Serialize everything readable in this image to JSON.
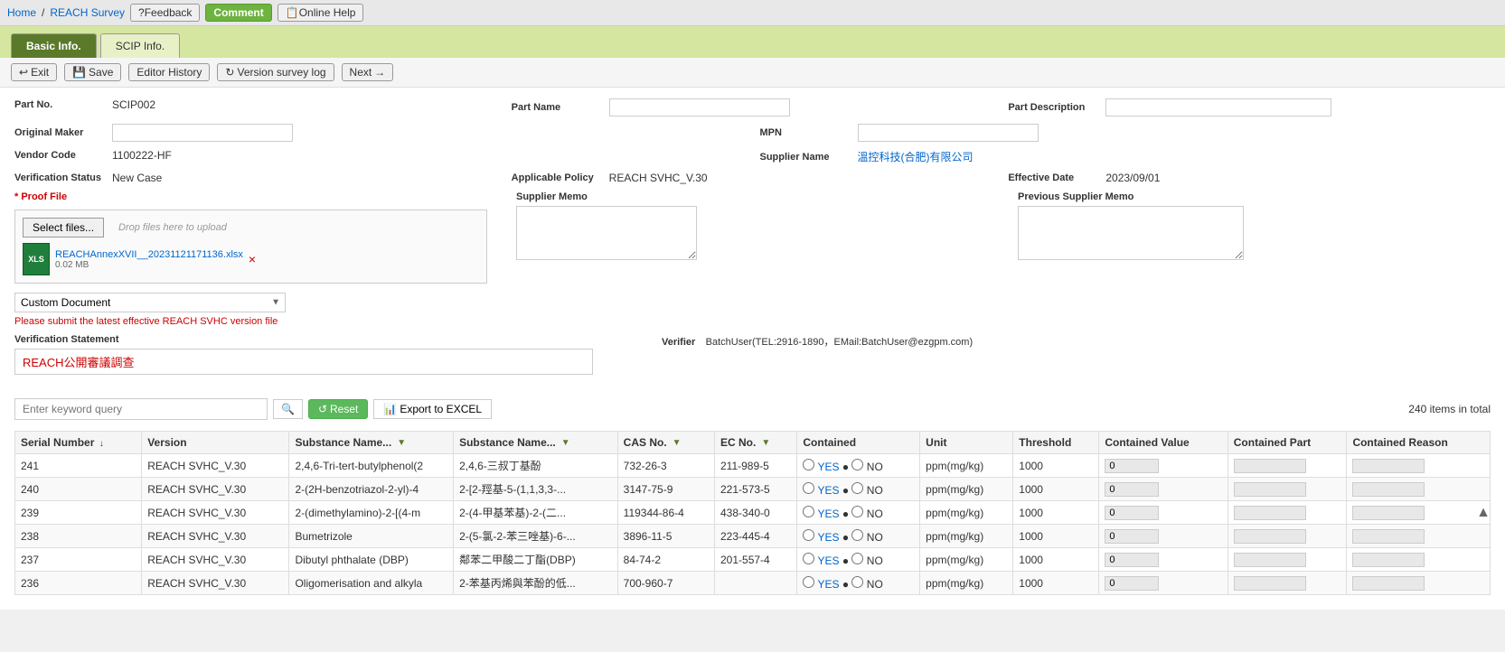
{
  "topNav": {
    "homeLabel": "Home",
    "separator": "/",
    "surveyLabel": "REACH Survey",
    "feedbackLabel": "?Feedback",
    "commentLabel": "Comment",
    "onlineHelpLabel": "📋Online Help"
  },
  "tabs": [
    {
      "id": "basic-info",
      "label": "Basic Info.",
      "active": true
    },
    {
      "id": "scip-info",
      "label": "SCIP Info.",
      "active": false
    }
  ],
  "toolbar": {
    "exitLabel": "Exit",
    "saveLabel": "Save",
    "editorHistoryLabel": "Editor History",
    "versionSurveyLogLabel": "Version survey log",
    "nextLabel": "Next",
    "nextArrow": "→"
  },
  "form": {
    "partNoLabel": "Part No.",
    "partNoValue": "SCIP002",
    "partNameLabel": "Part Name",
    "partNameValue": "",
    "partDescriptionLabel": "Part Description",
    "partDescriptionValue": "",
    "originalMakerLabel": "Original Maker",
    "originalMakerValue": "",
    "mpnLabel": "MPN",
    "mpnValue": "",
    "vendorCodeLabel": "Vendor Code",
    "vendorCodeValue": "1100222-HF",
    "supplierNameLabel": "Supplier Name",
    "supplierNameValue": "溫控科技(合肥)有限公司",
    "verificationStatusLabel": "Verification Status",
    "verificationStatusValue": "New Case",
    "applicablePolicyLabel": "Applicable Policy",
    "applicablePolicyValue": "REACH SVHC_V.30",
    "effectiveDateLabel": "Effective Date",
    "effectiveDateValue": "2023/09/01",
    "proofFileLabel": "* Proof File",
    "selectFilesLabel": "Select files...",
    "dropFilesLabel": "Drop files here to upload",
    "fileName": "REACHAnnexXVII__20231121171136.xlsx",
    "fileSize": "0.02 MB",
    "customDocumentLabel": "Custom Document",
    "warningText": "Please submit the latest effective REACH SVHC version file",
    "supplierMemoLabel": "Supplier Memo",
    "previousSupplierMemoLabel": "Previous Supplier Memo",
    "verificationStatementLabel": "Verification Statement",
    "verificationStatementValue": "REACH公開審議調查",
    "verifierLabel": "Verifier",
    "verifierValue": "BatchUser(TEL:2916-1890，EMail:BatchUser@ezgpm.com)"
  },
  "search": {
    "placeholder": "Enter keyword query",
    "resetLabel": "Reset",
    "exportLabel": "Export to EXCEL",
    "totalItems": "240 items in total"
  },
  "table": {
    "columns": [
      {
        "id": "serial",
        "label": "Serial Number",
        "sortable": true
      },
      {
        "id": "version",
        "label": "Version",
        "sortable": false
      },
      {
        "id": "substanceNameEn",
        "label": "Substance Name...",
        "filterable": true
      },
      {
        "id": "substanceNameZh",
        "label": "Substance Name...",
        "filterable": true
      },
      {
        "id": "casNo",
        "label": "CAS No.",
        "filterable": true
      },
      {
        "id": "ecNo",
        "label": "EC No.",
        "filterable": true
      },
      {
        "id": "contained",
        "label": "Contained",
        "sortable": false
      },
      {
        "id": "unit",
        "label": "Unit",
        "sortable": false
      },
      {
        "id": "threshold",
        "label": "Threshold",
        "sortable": false
      },
      {
        "id": "containedValue",
        "label": "Contained Value",
        "sortable": false
      },
      {
        "id": "containedPart",
        "label": "Contained Part",
        "sortable": false
      },
      {
        "id": "containedReason",
        "label": "Contained Reason",
        "sortable": false
      }
    ],
    "rows": [
      {
        "serial": "241",
        "version": "REACH SVHC_V.30",
        "substanceNameEn": "2,4,6-Tri-tert-butylphenol(2",
        "substanceNameZh": "2,4,6-三叔丁基酚",
        "casNo": "732-26-3",
        "ecNo": "211-989-5",
        "containedYes": "YES",
        "containedNo": "NO",
        "unit": "ppm(mg/kg)",
        "threshold": "1000",
        "containedValue": "0",
        "containedPart": "",
        "containedReason": ""
      },
      {
        "serial": "240",
        "version": "REACH SVHC_V.30",
        "substanceNameEn": "2-(2H-benzotriazol-2-yl)-4",
        "substanceNameZh": "2-[2-羥基-5-(1,1,3,3-...",
        "casNo": "3147-75-9",
        "ecNo": "221-573-5",
        "containedYes": "YES",
        "containedNo": "NO",
        "unit": "ppm(mg/kg)",
        "threshold": "1000",
        "containedValue": "0",
        "containedPart": "",
        "containedReason": ""
      },
      {
        "serial": "239",
        "version": "REACH SVHC_V.30",
        "substanceNameEn": "2-(dimethylamino)-2-[(4-m",
        "substanceNameZh": "2-(4-甲基苯基)-2-(二...",
        "casNo": "119344-86-4",
        "ecNo": "438-340-0",
        "containedYes": "YES",
        "containedNo": "NO",
        "unit": "ppm(mg/kg)",
        "threshold": "1000",
        "containedValue": "0",
        "containedPart": "",
        "containedReason": ""
      },
      {
        "serial": "238",
        "version": "REACH SVHC_V.30",
        "substanceNameEn": "Bumetrizole",
        "substanceNameZh": "2-(5-氯-2-苯三唑基)-6-...",
        "casNo": "3896-11-5",
        "ecNo": "223-445-4",
        "containedYes": "YES",
        "containedNo": "NO",
        "unit": "ppm(mg/kg)",
        "threshold": "1000",
        "containedValue": "0",
        "containedPart": "",
        "containedReason": ""
      },
      {
        "serial": "237",
        "version": "REACH SVHC_V.30",
        "substanceNameEn": "Dibutyl phthalate (DBP)",
        "substanceNameZh": "鄰苯二甲酸二丁酯(DBP)",
        "casNo": "84-74-2",
        "ecNo": "201-557-4",
        "containedYes": "YES",
        "containedNo": "NO",
        "unit": "ppm(mg/kg)",
        "threshold": "1000",
        "containedValue": "0",
        "containedPart": "",
        "containedReason": ""
      },
      {
        "serial": "236",
        "version": "REACH SVHC_V.30",
        "substanceNameEn": "Oligomerisation and alkyla",
        "substanceNameZh": "2-苯基丙烯與苯酚的低...",
        "casNo": "700-960-7",
        "ecNo": "",
        "containedYes": "YES",
        "containedNo": "NO",
        "unit": "ppm(mg/kg)",
        "threshold": "1000",
        "containedValue": "0",
        "containedPart": "",
        "containedReason": ""
      }
    ]
  }
}
